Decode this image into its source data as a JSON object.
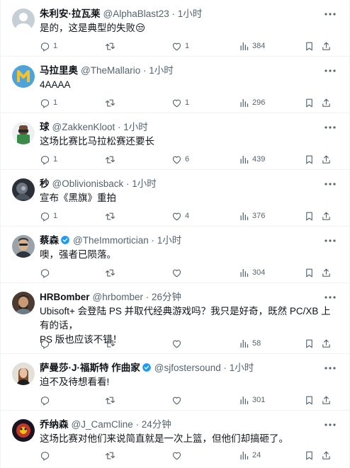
{
  "icons": {
    "more": "more-dots-icon",
    "reply": "reply-icon",
    "retweet": "retweet-icon",
    "like": "heart-icon",
    "views": "views-chart-icon",
    "bookmark": "bookmark-icon",
    "share": "share-icon",
    "verified": "verified-badge-icon"
  },
  "colors": {
    "text": "#0f1419",
    "muted": "#536471",
    "divider": "#eff3f4",
    "verified": "#1d9bf0"
  },
  "tweets": [
    {
      "name": "朱利安·拉瓦莱",
      "handle": "@AlphaBlast23",
      "dot": "·",
      "time": "1小时",
      "text": "是的，这是典型的失败😒",
      "reply": "1",
      "retweet": "",
      "like": "1",
      "views": "384"
    },
    {
      "name": "马拉里奥",
      "handle": "@TheMallario",
      "dot": "·",
      "time": "1小时",
      "text": "4AAAA",
      "reply": "1",
      "retweet": "",
      "like": "1",
      "views": "296"
    },
    {
      "name": "球",
      "handle": "@ZakkenKloot",
      "dot": "·",
      "time": "1小时",
      "text": "这场比赛比马拉松赛还要长",
      "reply": "1",
      "retweet": "",
      "like": "6",
      "views": "439"
    },
    {
      "name": "秒",
      "handle": "@Oblivionisback",
      "dot": "·",
      "time": "1小时",
      "text": "宣布《黑旗》重拍",
      "reply": "1",
      "retweet": "",
      "like": "4",
      "views": "376"
    },
    {
      "name": "蔡森",
      "handle": "@TheImmortician",
      "dot": "·",
      "time": "1小时",
      "text": "噢，强者已陨落。",
      "reply": "",
      "retweet": "",
      "like": "",
      "views": "304"
    },
    {
      "name": "HRBomber",
      "handle": "@hrbomber",
      "dot": "·",
      "time": "26分钟",
      "text_lines": [
        "Ubisoft+ 会登陆 PS 并取代经典游戏吗？我只是好奇，既然 PC/XB 上有的话，",
        "PS 版也应该不错！"
      ],
      "reply": "",
      "retweet": "",
      "like": "",
      "views": "58"
    },
    {
      "name": "萨曼莎·J·福斯特 作曲家",
      "handle": "@sjfostersound",
      "dot": "·",
      "time": "1小时",
      "text": "迫不及待想看看!",
      "reply": "",
      "retweet": "",
      "like": "",
      "views": "301"
    },
    {
      "name": "乔纳森",
      "handle": "@J_CamCline",
      "dot": "·",
      "time": "24分钟",
      "text": "这场比赛对他们来说简直就是一次上篮，但他们却搞砸了。",
      "reply": "",
      "retweet": "",
      "like": "",
      "views": "24"
    }
  ]
}
